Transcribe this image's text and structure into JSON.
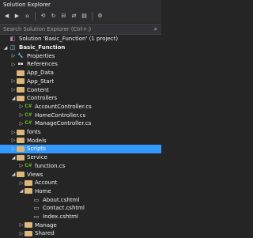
{
  "window": {
    "title": "Solution Explorer"
  },
  "toolbar": {
    "items": [
      "back-icon",
      "forward-icon",
      "home-icon",
      "history-icon",
      "refresh-icon",
      "collapse-icon",
      "sync-icon",
      "show-all-icon",
      "settings-icon"
    ]
  },
  "search": {
    "placeholder": "Search Solution Explorer (Ctrl+;)"
  },
  "tree": [
    {
      "label": "Solution 'Basic_Function' (1 project)",
      "icon": "solution-icon",
      "arrow": "",
      "level": 0
    },
    {
      "label": "Basic_Function",
      "icon": "project-icon",
      "arrow": "expanded",
      "level": 0,
      "bold": true
    },
    {
      "label": "Properties",
      "icon": "properties-icon",
      "arrow": "collapsed",
      "level": 1
    },
    {
      "label": "References",
      "icon": "references-icon",
      "arrow": "collapsed",
      "level": 1
    },
    {
      "label": "App_Data",
      "icon": "folder-icon",
      "arrow": "",
      "level": 1
    },
    {
      "label": "App_Start",
      "icon": "folder-icon",
      "arrow": "collapsed",
      "level": 1
    },
    {
      "label": "Content",
      "icon": "folder-icon",
      "arrow": "collapsed",
      "level": 1
    },
    {
      "label": "Controllers",
      "icon": "folder-icon",
      "arrow": "expanded",
      "level": 1
    },
    {
      "label": "AccountController.cs",
      "icon": "csharp-file-icon",
      "arrow": "collapsed",
      "level": 2
    },
    {
      "label": "HomeController.cs",
      "icon": "csharp-file-icon",
      "arrow": "collapsed",
      "level": 2
    },
    {
      "label": "ManageController.cs",
      "icon": "csharp-file-icon",
      "arrow": "collapsed",
      "level": 2
    },
    {
      "label": "fonts",
      "icon": "folder-icon",
      "arrow": "collapsed",
      "level": 1
    },
    {
      "label": "Models",
      "icon": "folder-icon",
      "arrow": "collapsed",
      "level": 1
    },
    {
      "label": "Scripts",
      "icon": "folder-icon",
      "arrow": "collapsed",
      "level": 1,
      "selected": true
    },
    {
      "label": "Service",
      "icon": "folder-icon",
      "arrow": "expanded",
      "level": 1
    },
    {
      "label": "function.cs",
      "icon": "csharp-file-icon",
      "arrow": "collapsed",
      "level": 2
    },
    {
      "label": "Views",
      "icon": "folder-icon",
      "arrow": "expanded",
      "level": 1
    },
    {
      "label": "Account",
      "icon": "folder-icon",
      "arrow": "collapsed",
      "level": 2
    },
    {
      "label": "Home",
      "icon": "folder-icon",
      "arrow": "expanded",
      "level": 2
    },
    {
      "label": "About.cshtml",
      "icon": "cshtml-file-icon",
      "arrow": "",
      "level": 3
    },
    {
      "label": "Contact.cshtml",
      "icon": "cshtml-file-icon",
      "arrow": "",
      "level": 3
    },
    {
      "label": "Index.cshtml",
      "icon": "cshtml-file-icon",
      "arrow": "",
      "level": 3
    },
    {
      "label": "Manage",
      "icon": "folder-icon",
      "arrow": "collapsed",
      "level": 2
    },
    {
      "label": "Shared",
      "icon": "folder-icon",
      "arrow": "collapsed",
      "level": 2
    }
  ]
}
